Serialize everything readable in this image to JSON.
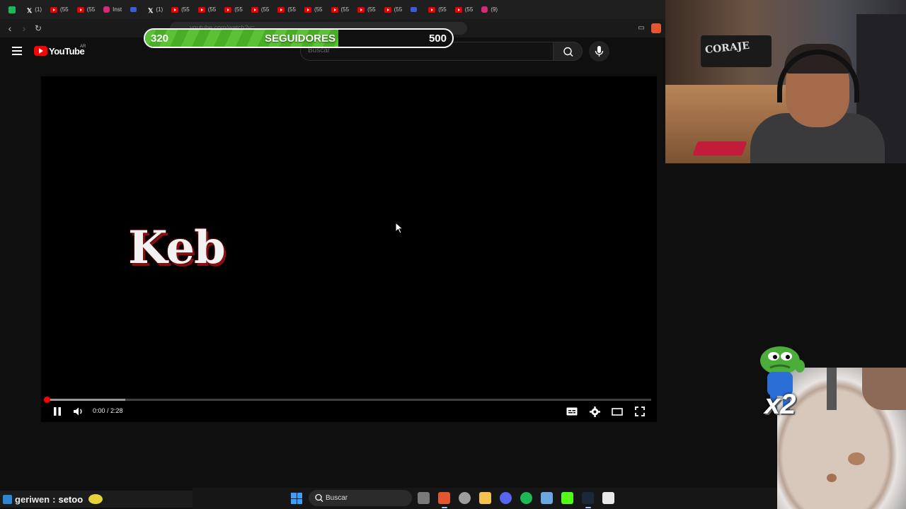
{
  "browser": {
    "tabs": [
      {
        "icon": "first",
        "label": ""
      },
      {
        "icon": "x",
        "label": "(1)"
      },
      {
        "icon": "yt",
        "label": "(55"
      },
      {
        "icon": "yt",
        "label": "(55"
      },
      {
        "icon": "ig",
        "label": "Inst"
      },
      {
        "icon": "tw",
        "label": ""
      },
      {
        "icon": "x",
        "label": "(1)"
      },
      {
        "icon": "yt",
        "label": "(55"
      },
      {
        "icon": "yt",
        "label": "(55"
      },
      {
        "icon": "yt",
        "label": "(55"
      },
      {
        "icon": "yt",
        "label": "(55"
      },
      {
        "icon": "yt",
        "label": "(55"
      },
      {
        "icon": "yt",
        "label": "(55"
      },
      {
        "icon": "yt",
        "label": "(55"
      },
      {
        "icon": "yt",
        "label": "(55"
      },
      {
        "icon": "yt",
        "label": "(55"
      },
      {
        "icon": "tw",
        "label": ""
      },
      {
        "icon": "yt",
        "label": "(55"
      },
      {
        "icon": "yt",
        "label": "(55"
      },
      {
        "icon": "ig",
        "label": "(9)"
      }
    ],
    "url": "youtube.com/watch?v=..."
  },
  "goal": {
    "start": "320",
    "label": "SEGUIDORES",
    "end": "500",
    "progress": 0.63,
    "fill_color": "#5bc236"
  },
  "youtube": {
    "logo_text": "YouTube",
    "region": "AR",
    "search_placeholder": "Buscar"
  },
  "player": {
    "title_art": "Keb",
    "time": "0:00 / 2:28",
    "played_fraction": 0.0,
    "buffered_fraction": 0.13,
    "progress_color": "#ff0000"
  },
  "webcam": {
    "poster_text": "CORAJE"
  },
  "overlay": {
    "multiplier": "x2"
  },
  "chat": {
    "user": "geriwen",
    "separator": ":",
    "message": "setoo"
  },
  "taskbar": {
    "search_label": "Buscar",
    "icons": [
      "task-view-icon",
      "brave-icon",
      "chrome-icon",
      "file-explorer-icon",
      "discord-icon",
      "spotify-icon",
      "notepad-icon",
      "kick-icon",
      "steam-icon",
      "store-icon"
    ]
  }
}
